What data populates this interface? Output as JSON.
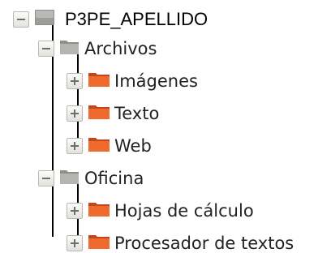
{
  "tree": {
    "root": {
      "label": "P3PE_APELLIDO",
      "state": "expanded",
      "icon": "drive-icon"
    },
    "folders": [
      {
        "label": "Archivos",
        "state": "expanded",
        "icon": "folder-gray-icon",
        "children": [
          {
            "label": "Imágenes",
            "state": "collapsed",
            "icon": "folder-orange-icon"
          },
          {
            "label": "Texto",
            "state": "collapsed",
            "icon": "folder-orange-icon"
          },
          {
            "label": "Web",
            "state": "collapsed",
            "icon": "folder-orange-icon"
          }
        ]
      },
      {
        "label": "Oficina",
        "state": "expanded",
        "icon": "folder-gray-icon",
        "children": [
          {
            "label": "Hojas de cálculo",
            "state": "collapsed",
            "icon": "folder-orange-icon"
          },
          {
            "label": "Procesador de textos",
            "state": "collapsed",
            "icon": "folder-orange-icon"
          }
        ]
      }
    ],
    "colors": {
      "tree_line": "#000000",
      "gray_folder": "#a0a09c",
      "orange_folder": "#e8602a"
    }
  }
}
